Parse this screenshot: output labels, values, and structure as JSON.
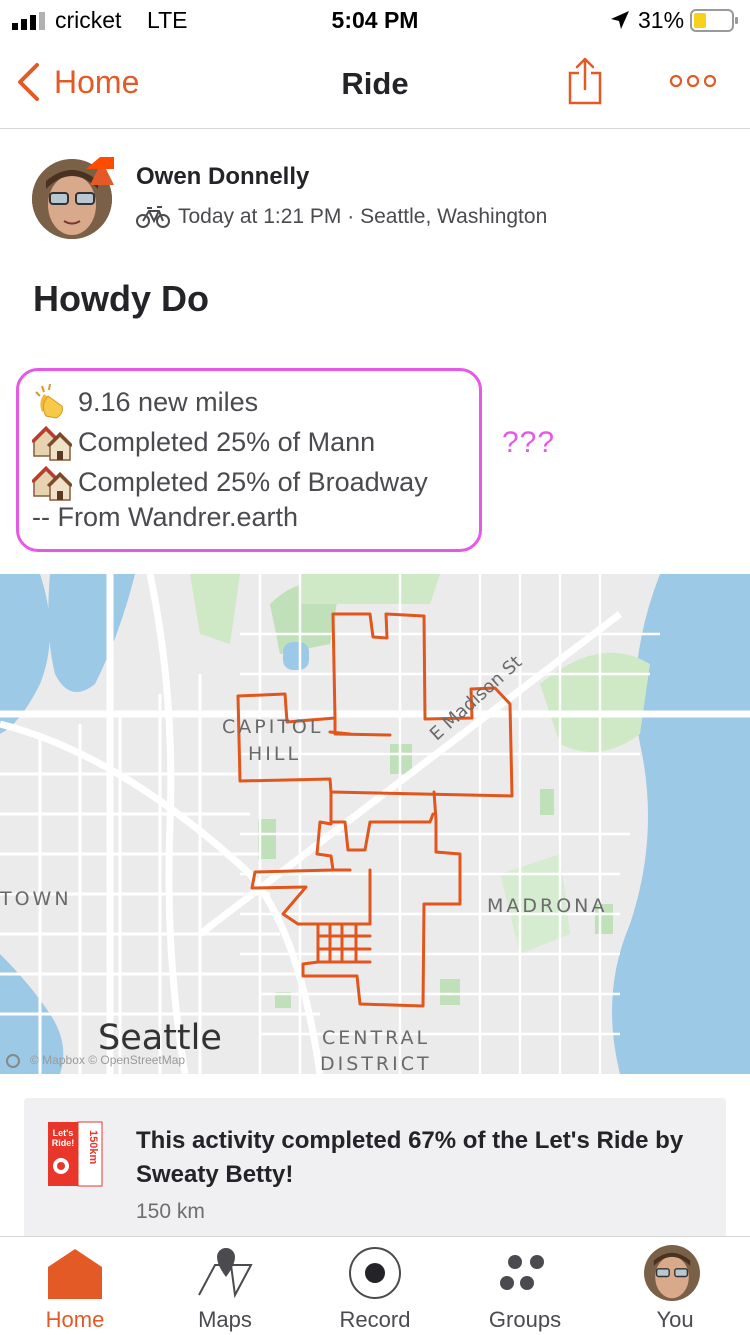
{
  "status_bar": {
    "carrier": "cricket",
    "network": "LTE",
    "time": "5:04 PM",
    "battery": "31%"
  },
  "nav": {
    "back_label": "Home",
    "title": "Ride"
  },
  "activity": {
    "athlete_name": "Owen Donnelly",
    "meta": "Today at 1:21 PM · Seattle, Washington",
    "title": "Howdy Do",
    "description_lines": [
      "9.16 new miles",
      "Completed 25% of Mann",
      "Completed 25% of Broadway",
      "-- From Wandrer.earth"
    ],
    "annotation": "???"
  },
  "map": {
    "labels": {
      "capitol": "CAPITOL",
      "hill": "HILL",
      "madison": "E Madison St",
      "town": "TOWN",
      "madrona": "MADRONA",
      "city": "Seattle",
      "central": "CENTRAL",
      "district": "DISTRICT",
      "attribution": "© Mapbox © OpenStreetMap"
    },
    "route_color": "#e0561c"
  },
  "challenge": {
    "title": "This activity completed 67% of the Let's Ride by Sweaty Betty!",
    "subtitle": "150 km",
    "badge_text": "Let's Ride!",
    "badge_side": "150km"
  },
  "tabs": [
    {
      "label": "Home",
      "icon": "home-icon",
      "active": true
    },
    {
      "label": "Maps",
      "icon": "map-icon",
      "active": false
    },
    {
      "label": "Record",
      "icon": "record-icon",
      "active": false
    },
    {
      "label": "Groups",
      "icon": "groups-icon",
      "active": false
    },
    {
      "label": "You",
      "icon": "profile-avatar",
      "active": false
    }
  ],
  "colors": {
    "accent": "#e35a27",
    "highlight": "#e559e8"
  }
}
